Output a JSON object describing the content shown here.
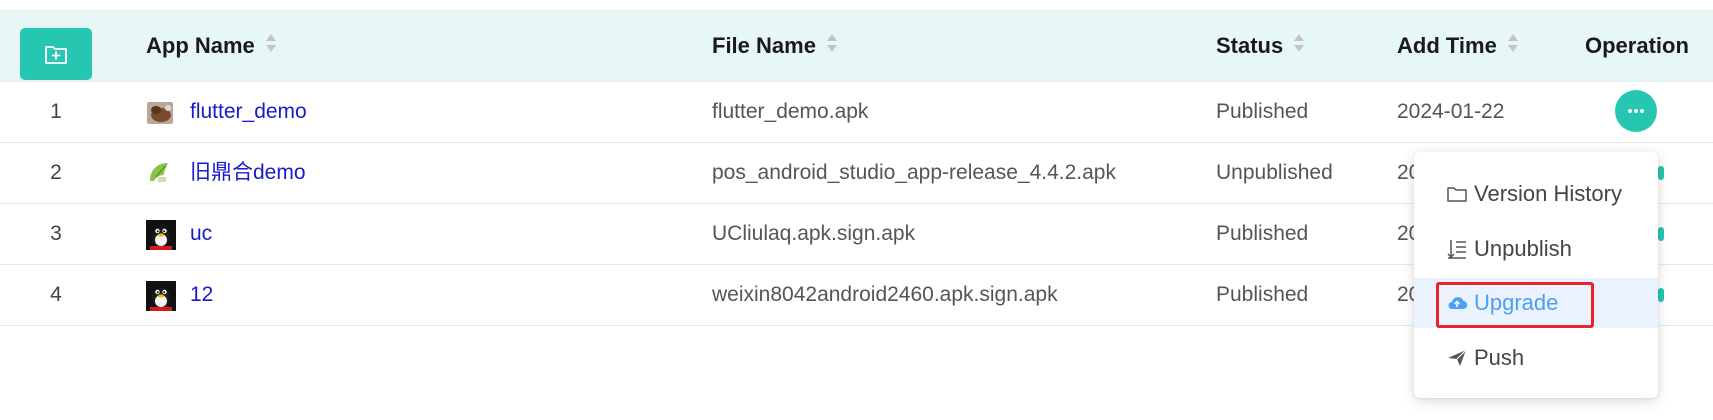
{
  "header": {
    "columns": {
      "app_name": "App Name",
      "file_name": "File Name",
      "status": "Status",
      "add_time": "Add Time",
      "operation": "Operation"
    }
  },
  "rows": [
    {
      "index": "1",
      "app_name": "flutter_demo",
      "file_name": "flutter_demo.apk",
      "status": "Published",
      "add_time": "2024-01-22",
      "icon": "photo-thumbnail-icon"
    },
    {
      "index": "2",
      "app_name": "旧鼎合demo",
      "file_name": "pos_android_studio_app-release_4.4.2.apk",
      "status": "Unpublished",
      "add_time": "20",
      "icon": "leaf-icon"
    },
    {
      "index": "3",
      "app_name": "uc",
      "file_name": "UCliulaq.apk.sign.apk",
      "status": "Published",
      "add_time": "20",
      "icon": "penguin-icon"
    },
    {
      "index": "4",
      "app_name": "12",
      "file_name": "weixin8042android2460.apk.sign.apk",
      "status": "Published",
      "add_time": "20",
      "icon": "penguin-icon"
    }
  ],
  "menu": {
    "items": [
      {
        "label": "Version History",
        "icon": "folder-icon"
      },
      {
        "label": "Unpublish",
        "icon": "sort-list-icon"
      },
      {
        "label": "Upgrade",
        "icon": "cloud-upload-icon"
      },
      {
        "label": "Push",
        "icon": "send-icon"
      }
    ]
  },
  "colors": {
    "accent": "#26c6b0",
    "header_bg": "#e6f7f6",
    "link": "#1a1acc",
    "menu_active_bg": "#eaf3fd",
    "menu_active_text": "#4d9ef5",
    "highlight_border": "#e8232a"
  }
}
